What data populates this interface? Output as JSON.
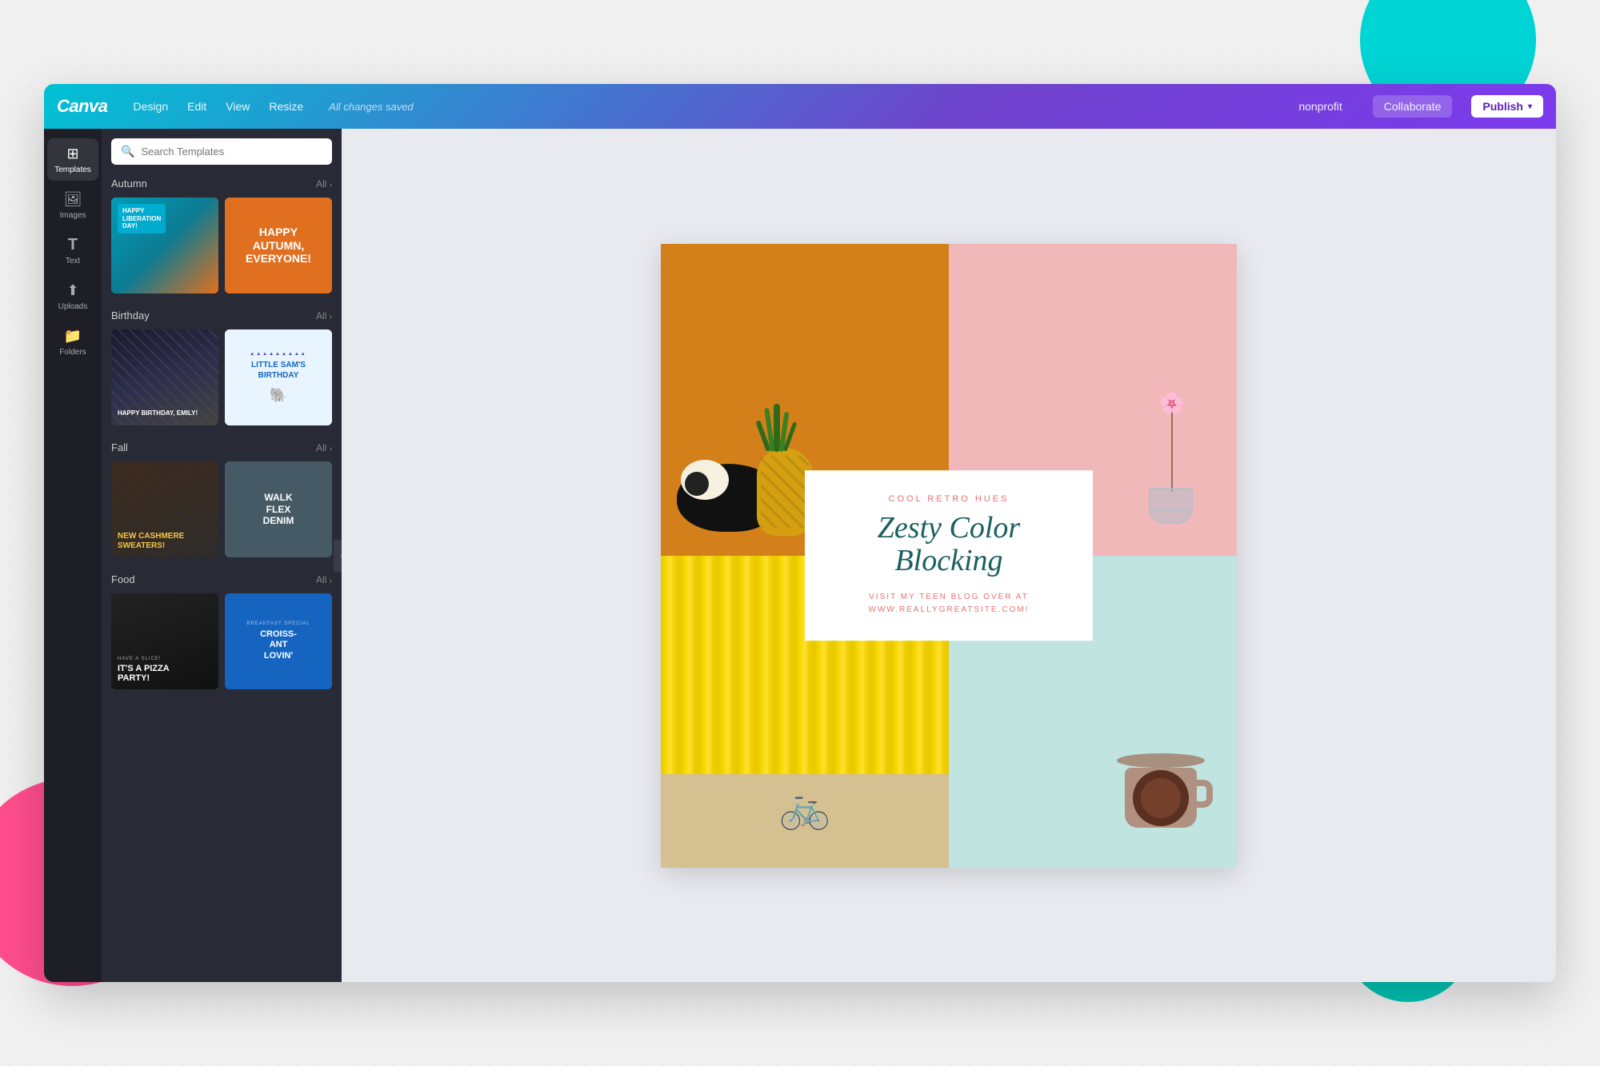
{
  "background": {
    "blob_cyan_color": "#00d4d4",
    "blob_pink_color": "#ff4d8d",
    "blob_teal_color": "#00c2b3"
  },
  "toolbar": {
    "logo": "Canva",
    "nav": {
      "design": "Design",
      "edit": "Edit",
      "view": "View",
      "resize": "Resize"
    },
    "status": "All changes saved",
    "right": {
      "nonprofit": "nonprofit",
      "collaborate": "Collaborate",
      "publish": "Publish",
      "publish_caret": "▾"
    }
  },
  "sidebar_icons": [
    {
      "id": "templates",
      "label": "Templates",
      "icon": "⊞",
      "active": true
    },
    {
      "id": "images",
      "label": "Images",
      "icon": "🖼"
    },
    {
      "id": "text",
      "label": "Text",
      "icon": "T"
    },
    {
      "id": "uploads",
      "label": "Uploads",
      "icon": "↑"
    },
    {
      "id": "folders",
      "label": "Folders",
      "icon": "📁"
    }
  ],
  "search": {
    "placeholder": "Search Templates"
  },
  "categories": [
    {
      "name": "Autumn",
      "all_label": "All",
      "templates": [
        {
          "id": "autumn-1",
          "text": "HAPPY LIBERATION DAY!"
        },
        {
          "id": "autumn-2",
          "text": "HAPPY AUTUMN, EVERYONE!"
        }
      ]
    },
    {
      "name": "Birthday",
      "all_label": "All",
      "templates": [
        {
          "id": "bday-1",
          "text": "HAPPY BIRTHDAY, EMILY!"
        },
        {
          "id": "bday-2",
          "title": "LITTLE SAM'S BIRTHDAY"
        }
      ]
    },
    {
      "name": "Fall",
      "all_label": "All",
      "templates": [
        {
          "id": "fall-1",
          "text": "NEW CASHMERE SWEATERS!"
        },
        {
          "id": "fall-2",
          "text": "WALK FLEX DENIM"
        }
      ]
    },
    {
      "name": "Food",
      "all_label": "All",
      "templates": [
        {
          "id": "food-1",
          "text": "IT'S A PIZZA PARTY!"
        },
        {
          "id": "food-2",
          "text": "CROISSANT LOVIN'"
        }
      ]
    }
  ],
  "canvas": {
    "center_subtitle": "COOL RETRO HUES",
    "center_title": "Zesty Color Blocking",
    "center_body": "VISIT MY TEEN BLOG OVER AT\nWWW.REALLYGREATSITE.COM!"
  }
}
